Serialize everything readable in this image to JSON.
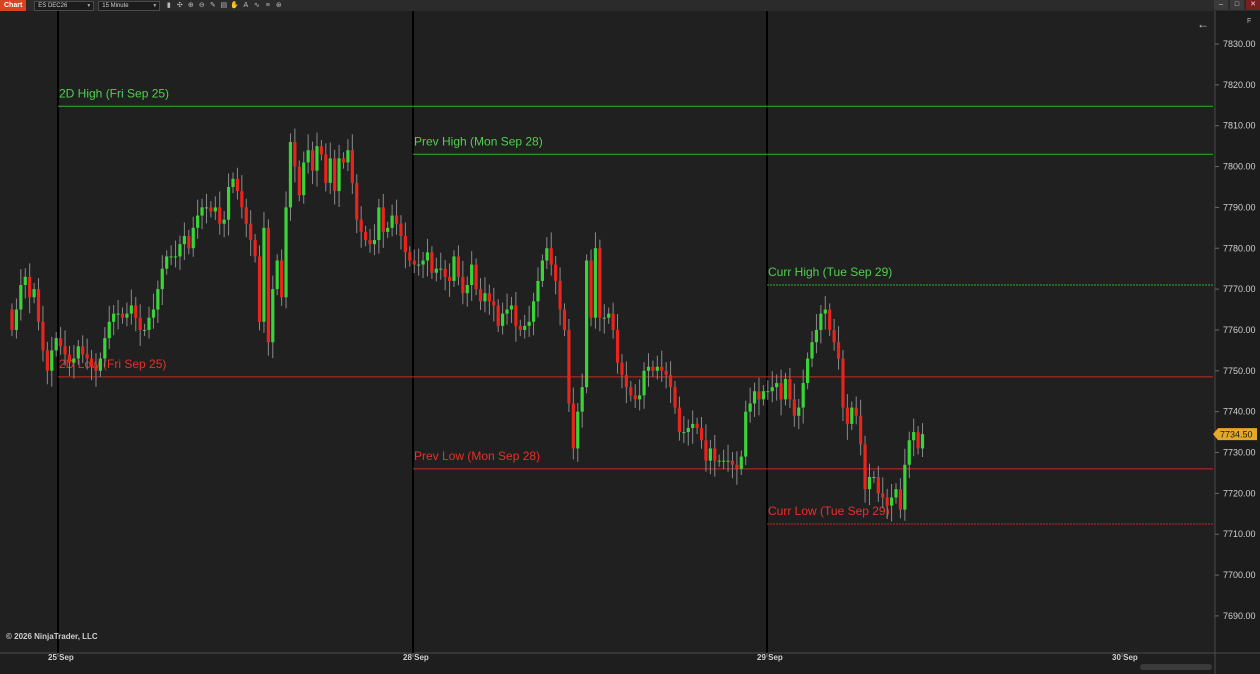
{
  "toolbar": {
    "tab_label": "Chart",
    "instrument": "ES DEC26",
    "interval": "15 Minute",
    "icons": [
      "bar-type-icon",
      "crosshair-icon",
      "zoom-in-icon",
      "zoom-out-icon",
      "drawing-tool-icon",
      "properties-icon",
      "hand-icon",
      "text-icon",
      "indicator-icon",
      "list-icon",
      "globe-icon"
    ],
    "window_buttons": [
      "minimize",
      "maximize",
      "close"
    ]
  },
  "copyright": "© 2026 NinjaTrader, LLC",
  "price_badge": "7734.50",
  "colors": {
    "background": "#1e1e1e",
    "up": "#38d438",
    "down": "#e8241c",
    "high_line": "#2fb02f",
    "low_line": "#c62a22",
    "separator": "#000000",
    "badge": "#e5a92a"
  },
  "chart_data": {
    "type": "candlestick",
    "instrument": "ES DEC26",
    "interval": "15 Minute",
    "y_axis": {
      "ylim": [
        7685,
        7835
      ],
      "ticks": [
        7690.0,
        7700.0,
        7710.0,
        7720.0,
        7730.0,
        7740.0,
        7750.0,
        7760.0,
        7770.0,
        7780.0,
        7790.0,
        7800.0,
        7810.0,
        7820.0,
        7830.0
      ]
    },
    "x_axis": {
      "ticks": [
        "25 Sep",
        "28 Sep",
        "29 Sep",
        "30 Sep"
      ]
    },
    "last_price": 7734.5,
    "levels": [
      {
        "label": "2D High (Fri Sep 25)",
        "price": 7814.75,
        "kind": "high",
        "from_session": "25 Sep"
      },
      {
        "label": "Prev High (Mon Sep 28)",
        "price": 7803.0,
        "kind": "high",
        "from_session": "28 Sep"
      },
      {
        "label": "Curr High (Tue Sep 29)",
        "price": 7771.0,
        "kind": "high",
        "from_session": "29 Sep"
      },
      {
        "label": "2D Low (Fri Sep 25)",
        "price": 7748.5,
        "kind": "low",
        "from_session": "25 Sep"
      },
      {
        "label": "Prev Low (Mon Sep 28)",
        "price": 7726.0,
        "kind": "low",
        "from_session": "28 Sep"
      },
      {
        "label": "Curr Low (Tue Sep 29)",
        "price": 7712.5,
        "kind": "low",
        "from_session": "29 Sep"
      }
    ],
    "closes": [
      7760,
      7765,
      7771,
      7773,
      7768,
      7770,
      7762,
      7755,
      7750,
      7755,
      7758,
      7756,
      7754,
      7752,
      7753,
      7756,
      7754,
      7753,
      7751,
      7750,
      7753,
      7758,
      7762,
      7764,
      7764,
      7763,
      7764,
      7766,
      7763,
      7760,
      7760,
      7763,
      7765,
      7770,
      7775,
      7778,
      7778,
      7778,
      7781,
      7783,
      7780,
      7785,
      7788,
      7790,
      7790,
      7789,
      7790,
      7786,
      7787,
      7795,
      7797,
      7794,
      7790,
      7786,
      7782,
      7778,
      7762,
      7785,
      7757,
      7770,
      7777,
      7768,
      7790,
      7806,
      7800,
      7793,
      7801,
      7804,
      7799,
      7805,
      7803,
      7796,
      7802,
      7794,
      7802,
      7801,
      7804,
      7796,
      7787,
      7784,
      7782,
      7781,
      7782,
      7790,
      7784,
      7785,
      7788,
      7786,
      7783,
      7779,
      7777,
      7776,
      7776,
      7777,
      7779,
      7774,
      7775,
      7775,
      7773,
      7772,
      7778,
      7773,
      7769,
      7771,
      7776,
      7770,
      7767,
      7769,
      7767,
      7766,
      7761,
      7764,
      7765,
      7766,
      7761,
      7760,
      7761,
      7762,
      7767,
      7772,
      7777,
      7780,
      7776,
      7772,
      7765,
      7760,
      7742,
      7731,
      7740,
      7746,
      7777,
      7763,
      7780,
      7763,
      7763,
      7764,
      7760,
      7752,
      7749,
      7746,
      7744,
      7743,
      7744,
      7750,
      7751,
      7750,
      7751,
      7750,
      7749,
      7746,
      7741,
      7735,
      7735,
      7736,
      7737,
      7736,
      7733,
      7728,
      7731,
      7728,
      7728,
      7728,
      7728,
      7727,
      7726,
      7729,
      7740,
      7742,
      7745,
      7743,
      7745,
      7745,
      7746,
      7747,
      7743,
      7748,
      7743,
      7739,
      7741,
      7747,
      7753,
      7757,
      7760,
      7764,
      7765,
      7760,
      7757,
      7753,
      7741,
      7737,
      7741,
      7739,
      7732,
      7721,
      7724,
      7724,
      7720,
      7719,
      7717,
      7719,
      7721,
      7716,
      7727,
      7733,
      7735,
      7731,
      7734.5
    ],
    "series": [
      {
        "name": "Candles",
        "description_note": ""
      }
    ]
  }
}
